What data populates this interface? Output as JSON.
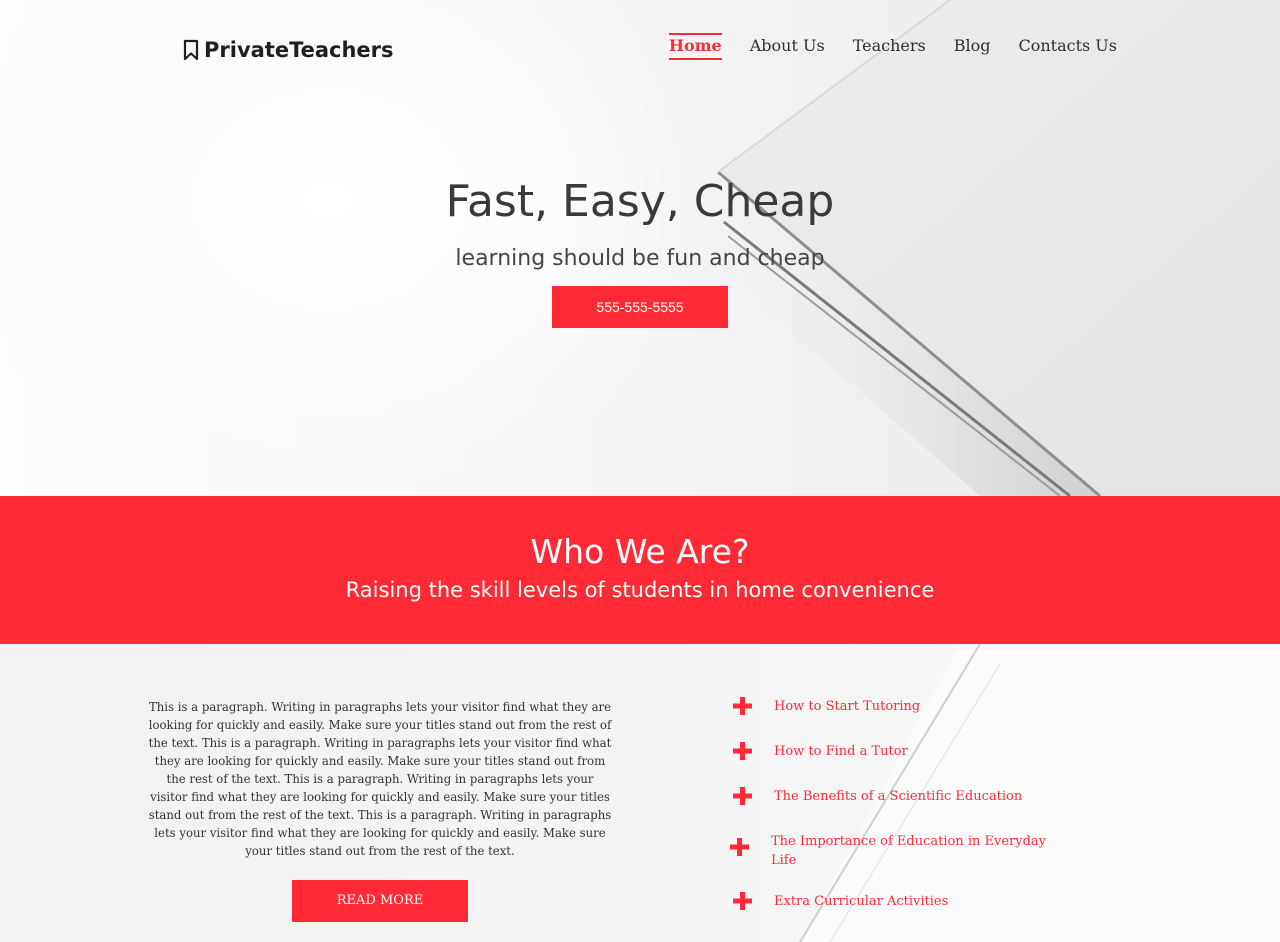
{
  "brand": {
    "name": "PrivateTeachers",
    "accent_color": "#ff2a36",
    "logo_icon": "bookmark-icon"
  },
  "nav": {
    "items": [
      {
        "label": "Home",
        "active": true
      },
      {
        "label": "About Us",
        "active": false
      },
      {
        "label": "Teachers",
        "active": false
      },
      {
        "label": "Blog",
        "active": false
      },
      {
        "label": "Contacts Us",
        "active": false
      }
    ]
  },
  "hero": {
    "title": "Fast, Easy, Cheap",
    "subtitle": "learning should be fun and cheap",
    "button_label": "555-555-5555"
  },
  "about": {
    "title": "Who We Are?",
    "subtitle": "Raising the skill levels of students in home convenience"
  },
  "content": {
    "paragraph": "This is a paragraph. Writing in paragraphs lets your visitor find what they are looking for quickly and easily. Make sure your titles stand out from the rest of the text. This is a paragraph. Writing in paragraphs lets your visitor find what they are looking for quickly and easily. Make sure your titles stand out from the rest of the text. This is a paragraph. Writing in paragraphs lets your visitor find what they are looking for quickly and easily. Make sure your titles stand out from the rest of the text. This is a paragraph. Writing in paragraphs lets your visitor find what they are looking for quickly and easily. Make sure your titles stand out from the rest of the text.",
    "read_more_label": "READ MORE"
  },
  "links": {
    "icon": "plus-icon",
    "items": [
      {
        "label": "How to Start Tutoring"
      },
      {
        "label": "How to Find a Tutor"
      },
      {
        "label": "The Benefits of a Scientific Education"
      },
      {
        "label": "The Importance of Education in Everyday Life"
      },
      {
        "label": "Extra Curricular Activities"
      }
    ]
  }
}
